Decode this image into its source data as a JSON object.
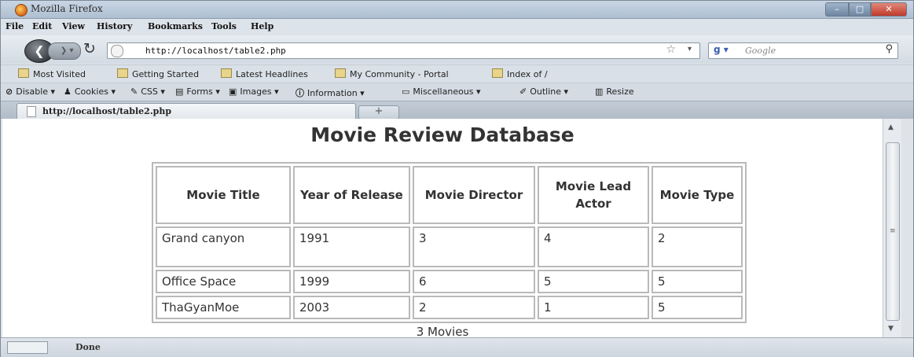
{
  "window": {
    "title": "Mozilla Firefox"
  },
  "menu": [
    "File",
    "Edit",
    "View",
    "History",
    "Bookmarks",
    "Tools",
    "Help"
  ],
  "nav": {
    "url": "http://localhost/table2.php",
    "search_placeholder": "Google",
    "icons": [
      "back-icon",
      "forward-icon",
      "reload-icon",
      "stop-icon",
      "home-icon"
    ]
  },
  "bookmarks": [
    "Most Visited",
    "Getting Started",
    "Latest Headlines",
    "My Community - Portal",
    "Index of /"
  ],
  "devbar": [
    "Disable",
    "Cookies",
    "CSS",
    "Forms",
    "Images",
    "Information",
    "Miscellaneous",
    "Outline",
    "Resize"
  ],
  "tab": {
    "label": "http://localhost/table2.php",
    "new_tab": "+"
  },
  "page": {
    "title": "Movie Review Database",
    "headers": [
      "Movie Title",
      "Year of Release",
      "Movie Director",
      "Movie Lead Actor",
      "Movie Type"
    ],
    "rows": [
      [
        "Grand canyon",
        "1991",
        "3",
        "4",
        "2"
      ],
      [
        "Office Space",
        "1999",
        "6",
        "5",
        "5"
      ],
      [
        "ThaGyanMoe",
        "2003",
        "2",
        "1",
        "5"
      ]
    ],
    "count": "3 Movies"
  },
  "status": {
    "text": "Done"
  }
}
